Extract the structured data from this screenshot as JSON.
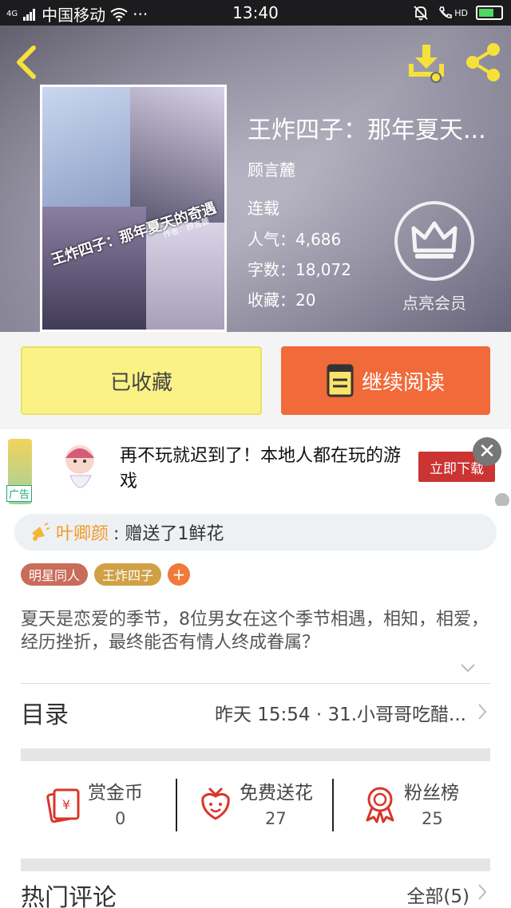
{
  "status_bar": {
    "carrier": "中国移动",
    "network": "4G",
    "time": "13:40",
    "more": "···",
    "hd": "HD"
  },
  "book": {
    "title": "王炸四子：那年夏天...",
    "author": "顾言麓",
    "status": "连载",
    "popularity_label": "人气：",
    "popularity": "4,686",
    "words_label": "字数：",
    "words": "18,072",
    "favorites_label": "收藏：",
    "favorites": "20",
    "cover_caption": "王炸四子：那年夏天的奇遇",
    "cover_signature": "作者：顾言麓"
  },
  "vip": {
    "label": "点亮会员"
  },
  "actions": {
    "collect_label": "已收藏",
    "read_label": "继续阅读"
  },
  "ad": {
    "text": "再不玩就迟到了！本地人都在玩的游戏",
    "cta": "立即下载",
    "tag": "广告"
  },
  "gift": {
    "user": "叶卿颜",
    "action": ": 赠送了1鲜花"
  },
  "tags": [
    "明星同人",
    "王炸四子"
  ],
  "description": "夏天是恋爱的季节，8位男女在这个季节相遇，相知，相爱，经历挫折，最终能否有情人终成眷属？",
  "toc": {
    "title": "目录",
    "latest": "昨天 15:54 · 31.小哥哥吃醋..."
  },
  "stats": [
    {
      "label": "赏金币",
      "value": "0"
    },
    {
      "label": "免费送花",
      "value": "27"
    },
    {
      "label": "粉丝榜",
      "value": "25"
    }
  ],
  "comments": {
    "title": "热门评论",
    "all": "全部(5)"
  },
  "colors": {
    "collect_button": "#fbf286",
    "read_button": "#f06a3a",
    "gift_user": "#f09a2a",
    "icon_red": "#d9362b",
    "tag_1": "#c96c5a",
    "tag_2": "#cfa044"
  }
}
